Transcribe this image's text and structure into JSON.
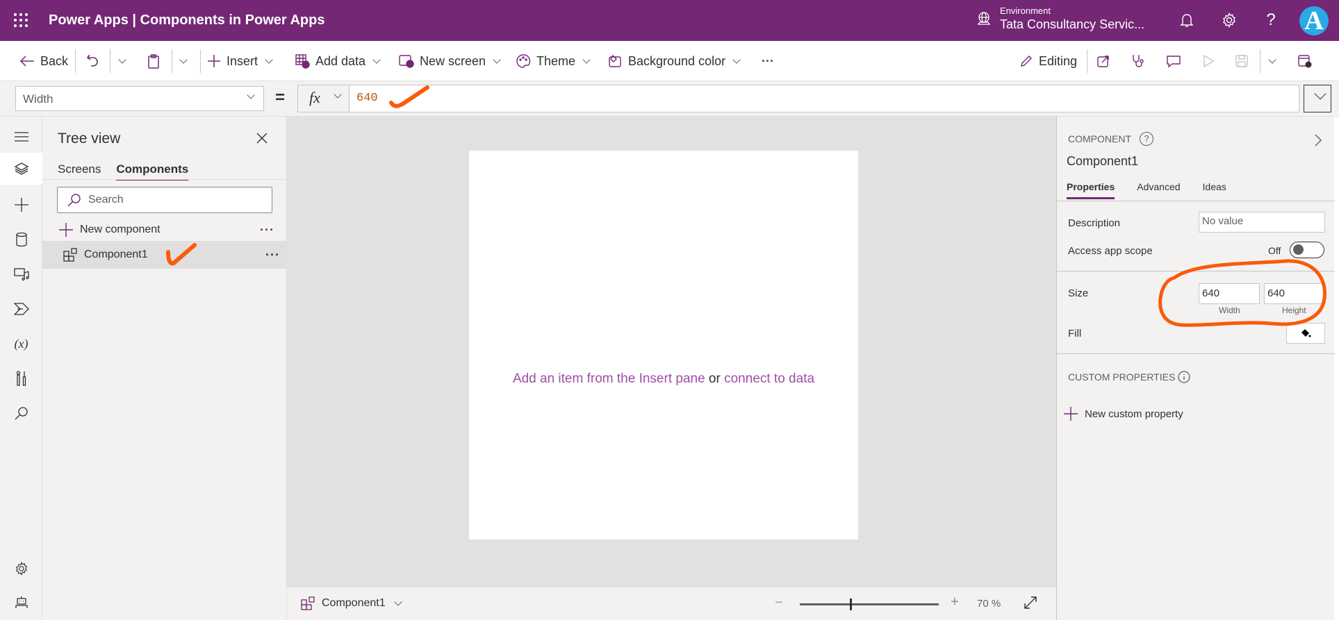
{
  "topbar": {
    "app_name": "Power Apps  |  Components in Power Apps",
    "environment_label": "Environment",
    "environment_value": "Tata Consultancy Servic...",
    "avatar_initial": "A",
    "brand_color": "#742774"
  },
  "toolbar": {
    "back": "Back",
    "insert": "Insert",
    "add_data": "Add data",
    "new_screen": "New screen",
    "theme": "Theme",
    "background_color": "Background color",
    "more": "···",
    "editing": "Editing"
  },
  "formula_bar": {
    "property": "Width",
    "equals": "=",
    "fx": "fx",
    "value": "640"
  },
  "tree_view": {
    "title": "Tree view",
    "tabs": [
      {
        "label": "Screens",
        "active": false
      },
      {
        "label": "Components",
        "active": true
      }
    ],
    "search_placeholder": "Search",
    "new_component": "New component",
    "items": [
      {
        "label": "Component1",
        "selected": true
      }
    ],
    "more": "···"
  },
  "canvas": {
    "message_part1": "Add an item from the Insert pane",
    "message_or": " or ",
    "message_part2": "connect to data"
  },
  "bottom_bar": {
    "screen_name": "Component1",
    "zoom_minus": "−",
    "zoom_plus": "+",
    "zoom_value": "70  %",
    "zoom_percent": 70
  },
  "properties_panel": {
    "kicker": "COMPONENT",
    "help": "?",
    "name": "Component1",
    "tabs": [
      {
        "label": "Properties",
        "active": true
      },
      {
        "label": "Advanced",
        "active": false
      },
      {
        "label": "Ideas",
        "active": false
      }
    ],
    "description_label": "Description",
    "description_placeholder": "No value",
    "access_scope_label": "Access app scope",
    "access_scope_state": "Off",
    "size_label": "Size",
    "width_value": "640",
    "height_value": "640",
    "width_caption": "Width",
    "height_caption": "Height",
    "fill_label": "Fill",
    "custom_properties_title": "CUSTOM PROPERTIES",
    "new_custom_property": "New custom property"
  },
  "annotation_color": "#fa5a0a"
}
